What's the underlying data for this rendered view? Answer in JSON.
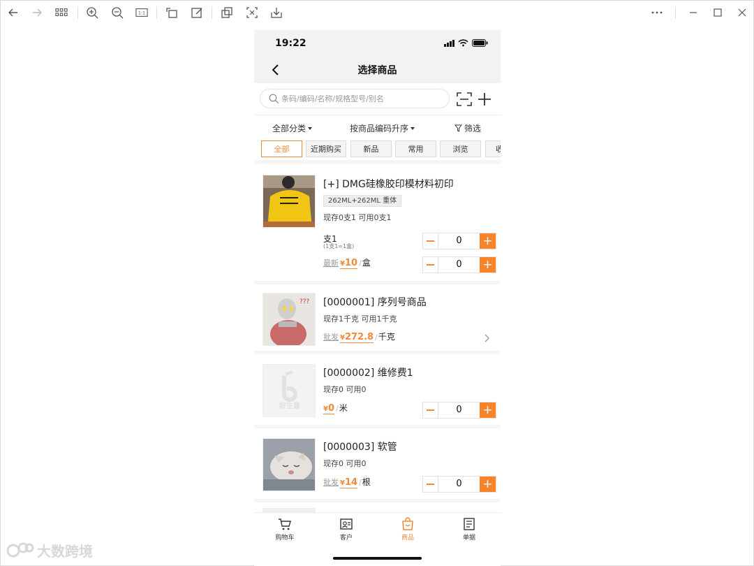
{
  "colors": {
    "accent": "#f7832c",
    "nav_bg": "#f2f2f2"
  },
  "phone": {
    "status_time": "19:22",
    "title": "选择商品",
    "search_placeholder": "条码/编码/名称/规格型号/别名",
    "filters": {
      "category": "全部分类",
      "sort": "按商品编码升序",
      "screen": "筛选"
    },
    "tabs": [
      "全部",
      "近期购买",
      "新品",
      "常用",
      "浏览",
      "收"
    ],
    "items": [
      {
        "name": "[+] DMG硅橡胶印模材料初印",
        "spec": "262ML+262ML 重体",
        "stock": "现存0支1   可用0支1",
        "unit_main": "支1",
        "unit_sub": "(1支1=1盒)",
        "qty1": "0",
        "price_label": "最新",
        "price_value": "10",
        "price_unit": "盒",
        "qty2": "0"
      },
      {
        "name": "[0000001] 序列号商品",
        "stock": "现存1千克   可用1千克",
        "price_label": "批发",
        "price_value": "272.8",
        "price_unit": "千克"
      },
      {
        "name": "[0000002] 维修费1",
        "stock": "现存0   可用0",
        "price_label": "",
        "price_value": "0",
        "price_unit": "米",
        "qty": "0",
        "placeholder_text": "好生意"
      },
      {
        "name": "[0000003] 软管",
        "stock": "现存0   可用0",
        "price_label": "批发",
        "price_value": "14",
        "price_unit": "根",
        "qty": "0"
      }
    ],
    "currency": "¥",
    "tabbar": [
      "购物车",
      "客户",
      "商品",
      "单据"
    ]
  },
  "watermark": "大数跨境"
}
